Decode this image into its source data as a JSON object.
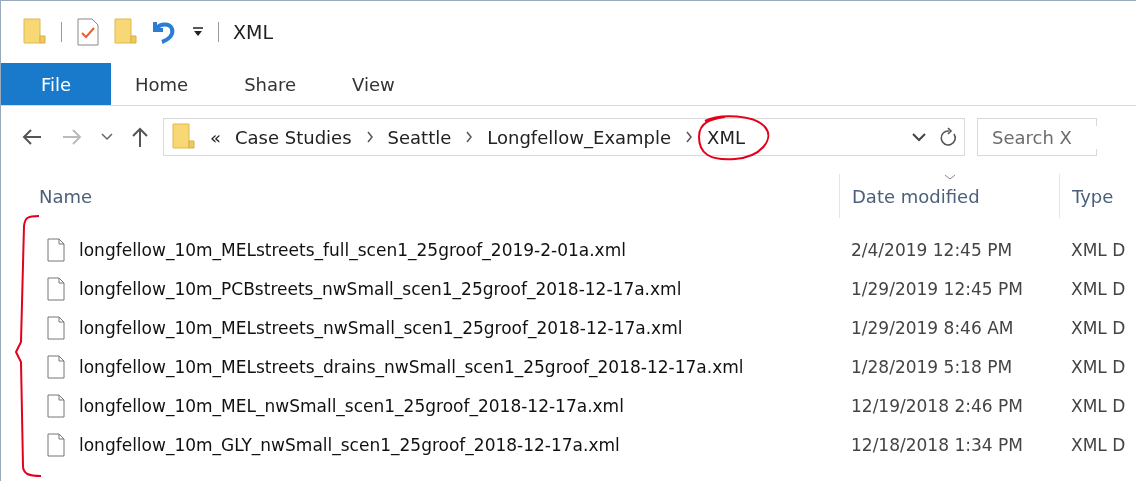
{
  "window": {
    "title": "XML"
  },
  "ribbon_tabs": [
    {
      "label": "File",
      "selected": true
    },
    {
      "label": "Home",
      "selected": false
    },
    {
      "label": "Share",
      "selected": false
    },
    {
      "label": "View",
      "selected": false
    }
  ],
  "address": {
    "overflow": "«",
    "crumbs": [
      "Case Studies",
      "Seattle",
      "Longfellow_Example",
      "XML"
    ]
  },
  "search": {
    "placeholder": "Search X"
  },
  "columns": [
    "Name",
    "Date modified",
    "Type"
  ],
  "rows": [
    {
      "name": "longfellow_10m_MELstreets_full_scen1_25groof_2019-2-01a.xml",
      "date": "2/4/2019 12:45 PM",
      "type": "XML D"
    },
    {
      "name": "longfellow_10m_PCBstreets_nwSmall_scen1_25groof_2018-12-17a.xml",
      "date": "1/29/2019 12:45 PM",
      "type": "XML D"
    },
    {
      "name": "longfellow_10m_MELstreets_nwSmall_scen1_25groof_2018-12-17a.xml",
      "date": "1/29/2019 8:46 AM",
      "type": "XML D"
    },
    {
      "name": "longfellow_10m_MELstreets_drains_nwSmall_scen1_25groof_2018-12-17a.xml",
      "date": "1/28/2019 5:18 PM",
      "type": "XML D"
    },
    {
      "name": "longfellow_10m_MEL_nwSmall_scen1_25groof_2018-12-17a.xml",
      "date": "12/19/2018 2:46 PM",
      "type": "XML D"
    },
    {
      "name": "longfellow_10m_GLY_nwSmall_scen1_25groof_2018-12-17a.xml",
      "date": "12/18/2018 1:34 PM",
      "type": "XML D"
    }
  ]
}
